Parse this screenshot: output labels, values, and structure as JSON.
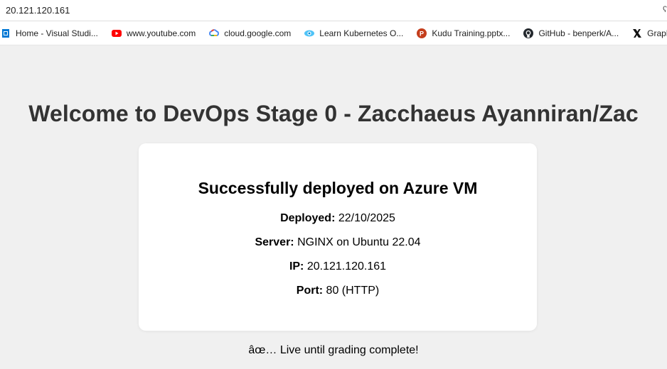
{
  "browser": {
    "address": "20.121.120.161",
    "bookmarks": [
      {
        "label": "Home - Visual Studi...",
        "icon": "visual-studio-icon",
        "color": "#0078d4"
      },
      {
        "label": "www.youtube.com",
        "icon": "youtube-icon",
        "color": "#ff0000"
      },
      {
        "label": "cloud.google.com",
        "icon": "google-cloud-icon",
        "color": "#4285f4"
      },
      {
        "label": "Learn Kubernetes O...",
        "icon": "kubernetes-learn-icon",
        "color": "#00bcd4"
      },
      {
        "label": "Kudu Training.pptx...",
        "icon": "powerpoint-icon",
        "color": "#c43e1c"
      },
      {
        "label": "GitHub - benperk/A...",
        "icon": "github-icon",
        "color": "#24292e"
      },
      {
        "label": "Graphi",
        "icon": "x-graph-icon",
        "color": "#111111"
      }
    ]
  },
  "page": {
    "title": "Welcome to DevOps Stage 0 - Zacchaeus Ayanniran/Zac",
    "card": {
      "heading": "Successfully deployed on Azure VM",
      "lines": [
        {
          "key": "Deployed:",
          "value": " 22/10/2025"
        },
        {
          "key": "Server:",
          "value": " NGINX on Ubuntu 22.04"
        },
        {
          "key": "IP:",
          "value": " 20.121.120.161"
        },
        {
          "key": "Port:",
          "value": " 80 (HTTP)"
        }
      ]
    },
    "footer": "âœ… Live until grading complete!"
  }
}
